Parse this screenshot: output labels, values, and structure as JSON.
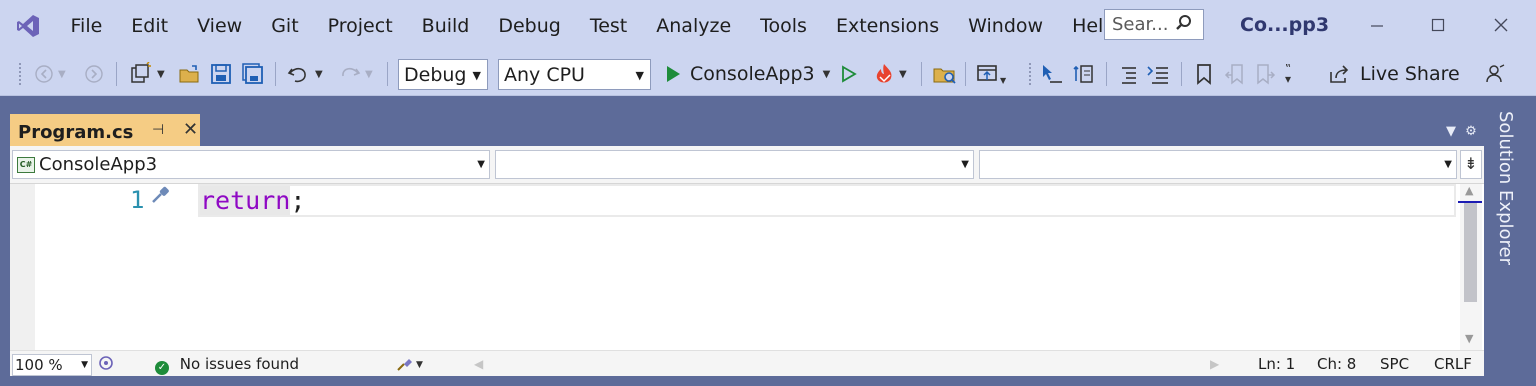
{
  "menubar": {
    "items": [
      "File",
      "Edit",
      "View",
      "Git",
      "Project",
      "Build",
      "Debug",
      "Test",
      "Analyze",
      "Tools",
      "Extensions",
      "Window",
      "Help"
    ],
    "search_placeholder": "Sear...",
    "window_title": "Co...pp3"
  },
  "toolbar": {
    "configuration": "Debug",
    "platform": "Any CPU",
    "start_project": "ConsoleApp3",
    "live_share": "Live Share"
  },
  "document": {
    "tab_name": "Program.cs"
  },
  "navbar": {
    "project": "ConsoleApp3",
    "project_icon_text": "C#",
    "type_scope": "",
    "member_scope": ""
  },
  "editor": {
    "line_number": "1",
    "keyword": "return",
    "punctuation": ";",
    "keyword_color": "#8f08c4",
    "line_number_color": "#2b91af"
  },
  "status": {
    "zoom": "100 %",
    "issues": "No issues found",
    "line": "Ln: 1",
    "col": "Ch: 8",
    "whitespace": "SPC",
    "line_ending": "CRLF"
  },
  "side_panel": {
    "label": "Solution Explorer"
  },
  "colors": {
    "chrome": "#ccd5f0",
    "frame": "#5d6b99",
    "active_tab": "#f5cc84",
    "run_green": "#1e8c3a"
  }
}
